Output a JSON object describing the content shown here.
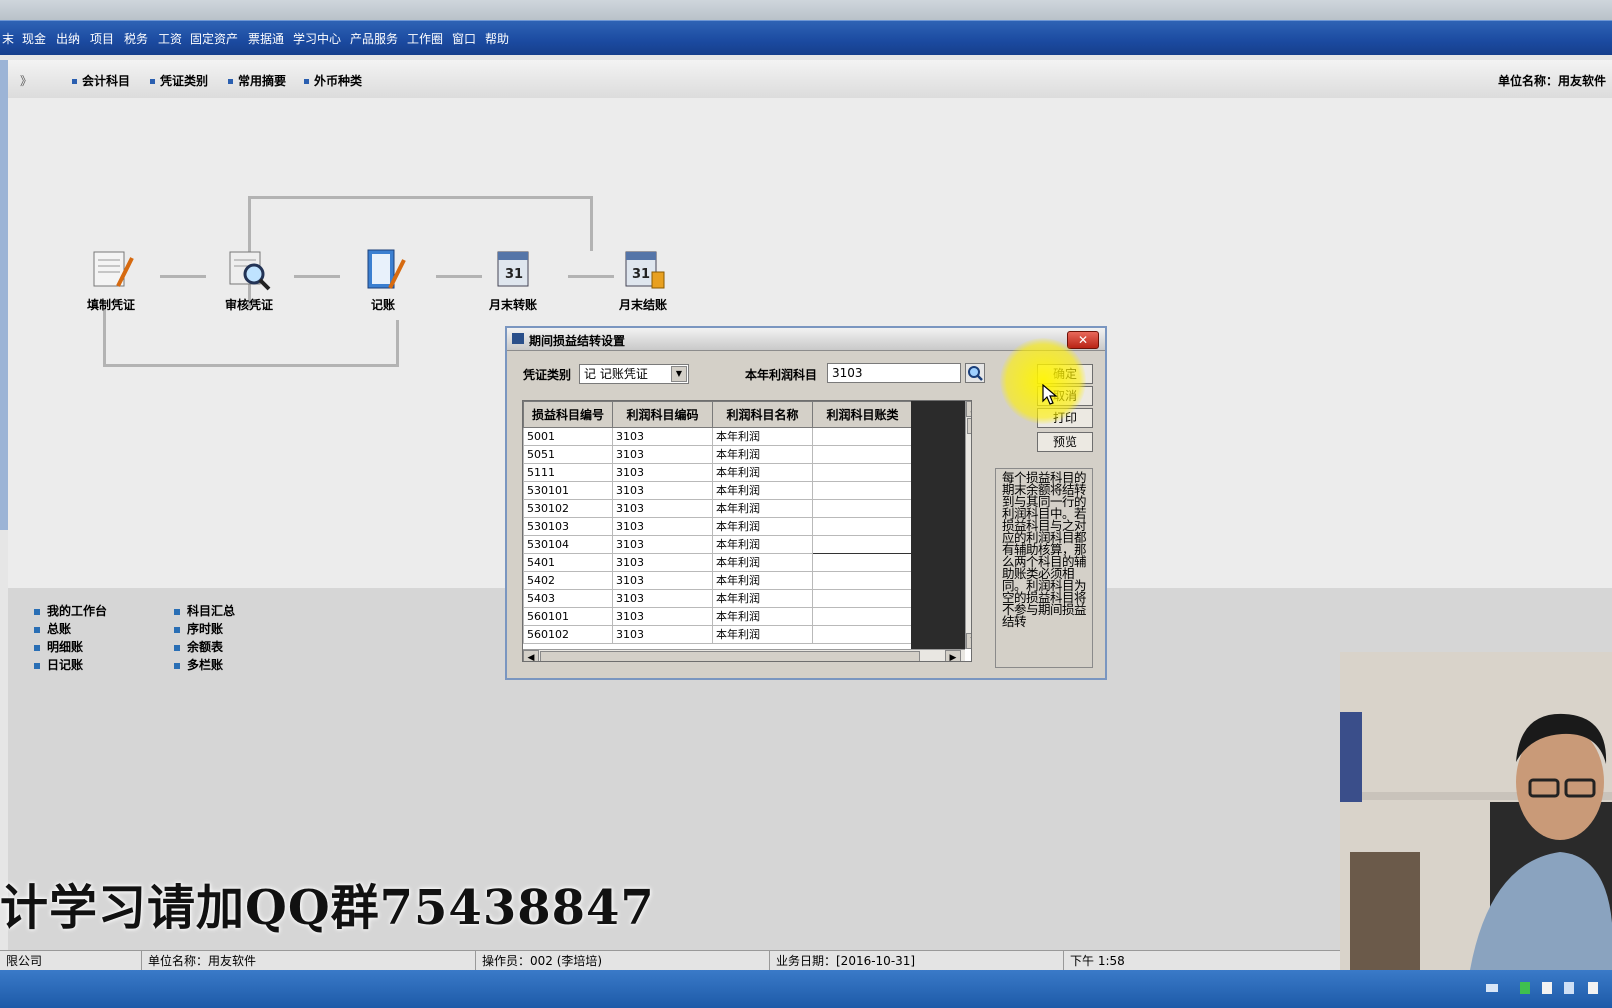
{
  "menu": [
    "末",
    "现金",
    "出纳",
    "项目",
    "税务",
    "工资",
    "固定资产",
    "票据通",
    "学习中心",
    "产品服务",
    "工作圈",
    "窗口",
    "帮助"
  ],
  "toolbar": {
    "expand_glyph": "》",
    "items": [
      "会计科目",
      "凭证类别",
      "常用摘要",
      "外币种类"
    ],
    "unit_name": "单位名称：用友软件"
  },
  "flow": {
    "nodes": [
      {
        "label": "填制凭证",
        "icon": "voucher-fill-icon"
      },
      {
        "label": "审核凭证",
        "icon": "voucher-audit-icon"
      },
      {
        "label": "记账",
        "icon": "bookkeeping-icon"
      },
      {
        "label": "月末转账",
        "icon": "month-end-transfer-icon"
      },
      {
        "label": "月末结账",
        "icon": "month-end-close-icon"
      }
    ]
  },
  "bottom_links": {
    "col1": [
      "我的工作台",
      "总账",
      "明细账",
      "日记账"
    ],
    "col2": [
      "科目汇总",
      "序时账",
      "余额表",
      "多栏账"
    ]
  },
  "watermark": "计学习请加QQ群75438847",
  "dialog": {
    "title": "期间损益结转设置",
    "voucher_type_label": "凭证类别",
    "voucher_type_value": "记   记账凭证",
    "profit_account_label": "本年利润科目",
    "profit_account_value": "3103",
    "buttons": {
      "ok": "确定",
      "cancel": "取消",
      "print": "打印",
      "preview": "预览"
    },
    "columns": [
      "损益科目编号",
      "利润科目编码",
      "利润科目名称",
      "利润科目账类"
    ],
    "rows": [
      [
        "5001",
        "3103",
        "本年利润",
        ""
      ],
      [
        "5051",
        "3103",
        "本年利润",
        ""
      ],
      [
        "5111",
        "3103",
        "本年利润",
        ""
      ],
      [
        "530101",
        "3103",
        "本年利润",
        ""
      ],
      [
        "530102",
        "3103",
        "本年利润",
        ""
      ],
      [
        "530103",
        "3103",
        "本年利润",
        ""
      ],
      [
        "530104",
        "3103",
        "本年利润",
        ""
      ],
      [
        "5401",
        "3103",
        "本年利润",
        ""
      ],
      [
        "5402",
        "3103",
        "本年利润",
        ""
      ],
      [
        "5403",
        "3103",
        "本年利润",
        ""
      ],
      [
        "560101",
        "3103",
        "本年利润",
        ""
      ],
      [
        "560102",
        "3103",
        "本年利润",
        ""
      ]
    ],
    "note": "每个损益科目的期末余额将结转到与其同一行的利润科目中。若损益科目与之对应的利润科目都有辅助核算，那么两个科目的辅助账类必须相同。利润科目为空的损益科目将不参与期间损益结转"
  },
  "status": {
    "company": "限公司",
    "unit": "单位名称：用友软件",
    "operator": "操作员：002 (李培培)",
    "date": "业务日期：[2016-10-31]",
    "time": "下午 1:58"
  }
}
